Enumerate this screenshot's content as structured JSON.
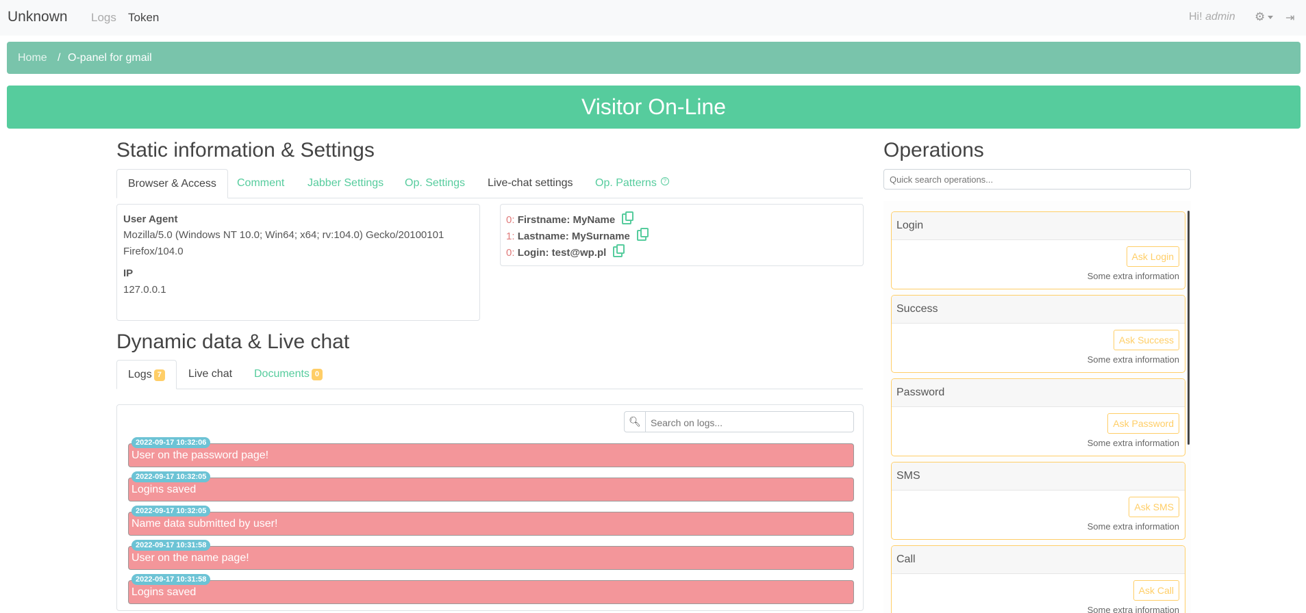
{
  "nav": {
    "brand": "Unknown",
    "links": [
      "Logs",
      "Token"
    ],
    "greeting": "Hi!",
    "user": "admin"
  },
  "breadcrumb": {
    "home": "Home",
    "separator": "/",
    "current": "O-panel for gmail"
  },
  "banner": {
    "title": "Visitor On-Line"
  },
  "static_section": {
    "title": "Static information & Settings",
    "tabs": [
      "Browser & Access",
      "Comment",
      "Jabber Settings",
      "Op. Settings",
      "Live-chat settings",
      "Op. Patterns"
    ],
    "user_agent_label": "User Agent",
    "user_agent_line1": "Mozilla/5.0 (Windows NT 10.0; Win64; x64; rv:104.0) Gecko/20100101",
    "user_agent_line2": "Firefox/104.0",
    "ip_label": "IP",
    "ip_value": "127.0.0.1",
    "fields": [
      {
        "index": "0:",
        "text": "Firstname: MyName"
      },
      {
        "index": "1:",
        "text": "Lastname: MySurname"
      },
      {
        "index": "0:",
        "text": "Login: test@wp.pl"
      }
    ]
  },
  "dynamic_section": {
    "title": "Dynamic data & Live chat",
    "tabs": [
      {
        "label": "Logs",
        "badge": "7"
      },
      {
        "label": "Live chat"
      },
      {
        "label": "Documents",
        "badge": "0"
      }
    ],
    "search_placeholder": "Search on logs...",
    "logs": [
      {
        "time": "2022-09-17 10:32:06",
        "text": "User on the password page!"
      },
      {
        "time": "2022-09-17 10:32:05",
        "text": "Logins saved"
      },
      {
        "time": "2022-09-17 10:32:05",
        "text": "Name data submitted by user!"
      },
      {
        "time": "2022-09-17 10:31:58",
        "text": "User on the name page!"
      },
      {
        "time": "2022-09-17 10:31:58",
        "text": "Logins saved"
      }
    ]
  },
  "operations": {
    "title": "Operations",
    "search_placeholder": "Quick search operations...",
    "items": [
      {
        "title": "Login",
        "button": "Ask Login",
        "info": "Some extra information"
      },
      {
        "title": "Success",
        "button": "Ask Success",
        "info": "Some extra information"
      },
      {
        "title": "Password",
        "button": "Ask Password",
        "info": "Some extra information"
      },
      {
        "title": "SMS",
        "button": "Ask SMS",
        "info": "Some extra information"
      },
      {
        "title": "Call",
        "button": "Ask Call",
        "info": "Some extra information"
      }
    ]
  },
  "colors": {
    "primary": "#56cc9d",
    "breadcrumb": "#79c4ab",
    "log_bg": "#f3969a",
    "timestamp": "#6cc3d5",
    "warning": "#ffce67"
  }
}
